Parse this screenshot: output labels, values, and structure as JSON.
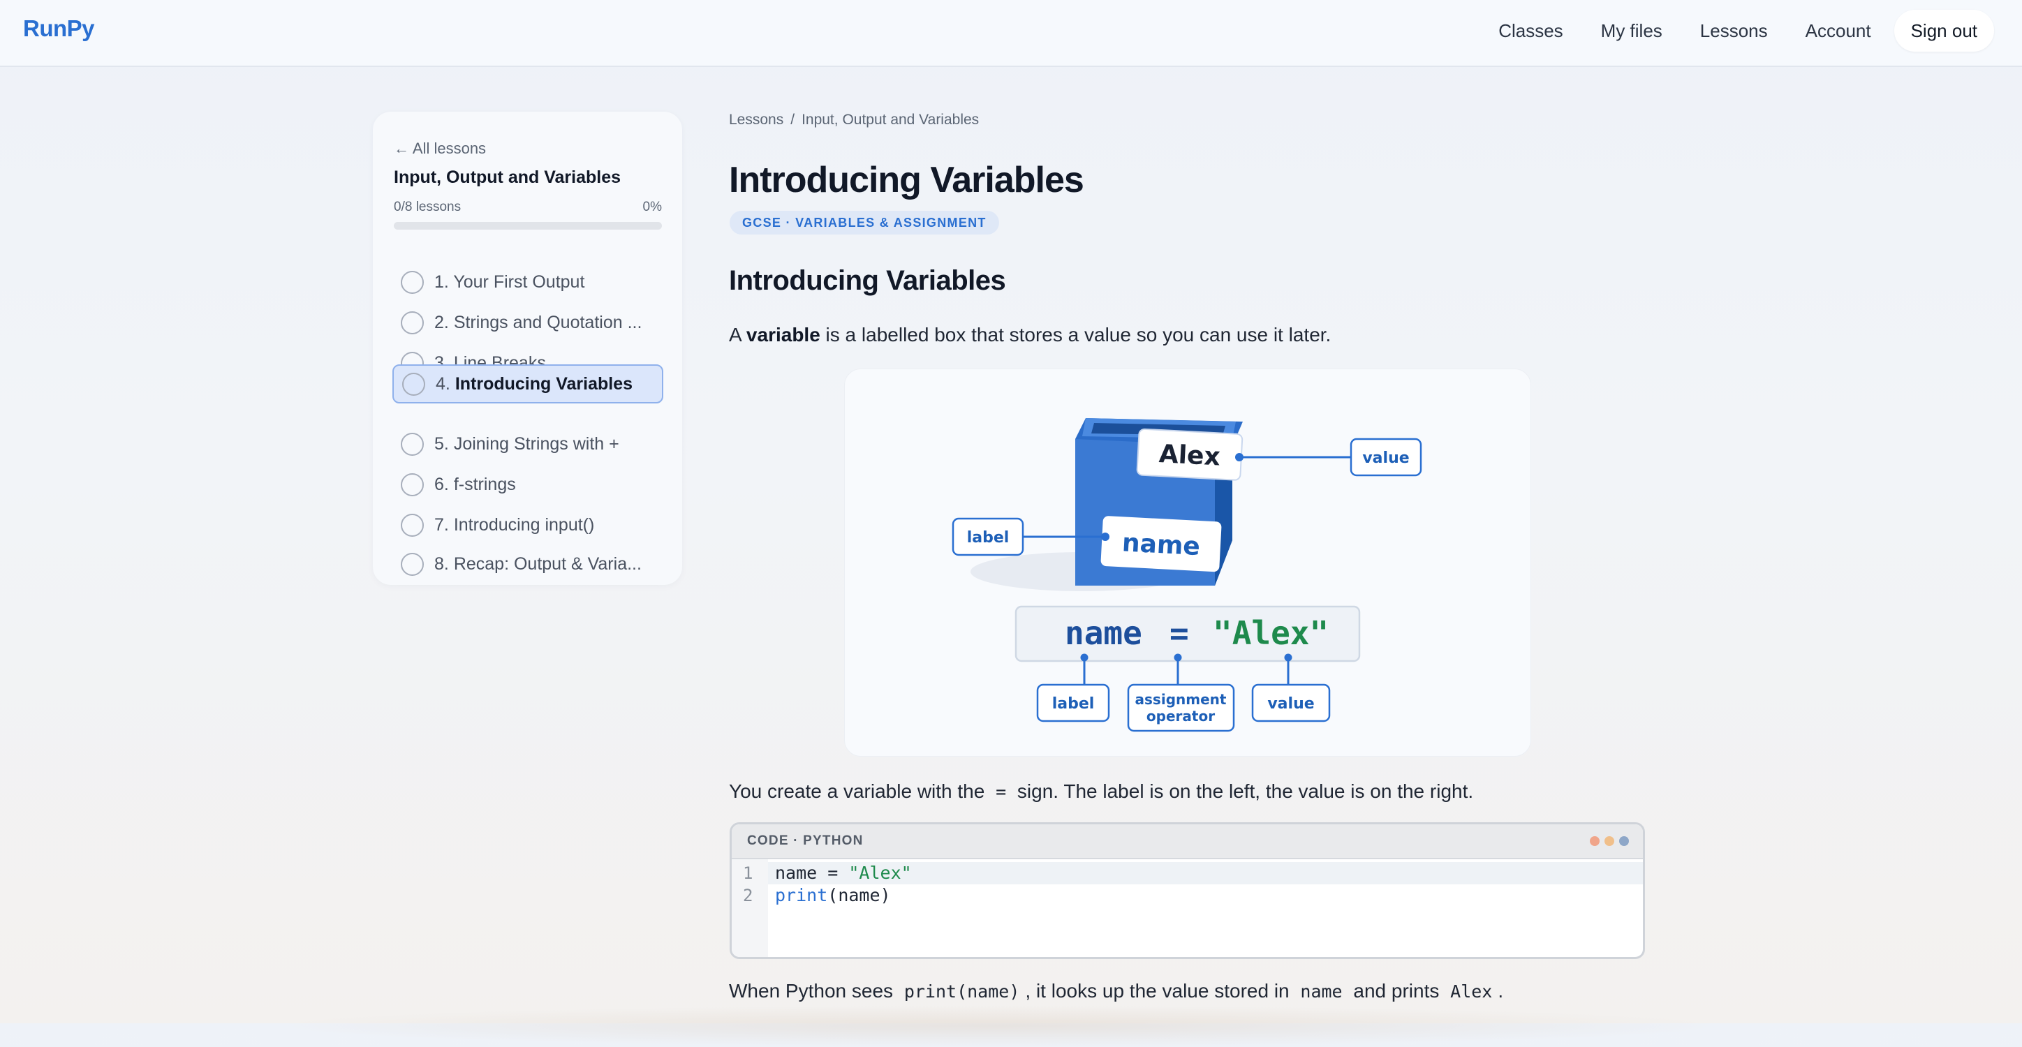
{
  "nav": {
    "brand": "RunPy",
    "links": [
      "Classes",
      "My files",
      "Lessons",
      "Account"
    ],
    "signout": "Sign out"
  },
  "sidebar": {
    "back": "← All lessons",
    "title": "Input, Output and Variables",
    "progress_label": "0/8 lessons",
    "progress_pct": "0%",
    "progress_fraction": 0,
    "lessons": [
      {
        "num": "1.",
        "title": "Your First Output"
      },
      {
        "num": "2.",
        "title": "Strings and Quotation ..."
      },
      {
        "num": "3.",
        "title": "Line Breaks"
      },
      {
        "num": "4.",
        "title": "Introducing Variables"
      },
      {
        "num": "5.",
        "title": "Joining Strings with +"
      },
      {
        "num": "6.",
        "title": "f-strings"
      },
      {
        "num": "7.",
        "title": "Introducing input()"
      },
      {
        "num": "8.",
        "title": "Recap: Output & Varia..."
      }
    ],
    "active_index": 3
  },
  "main": {
    "breadcrumb": [
      "Lessons",
      "/",
      "Input, Output and Variables"
    ],
    "title": "Introducing Variables",
    "tag": "GCSE · VARIABLES & ASSIGNMENT",
    "heading": "Introducing Variables",
    "intro_before": "A ",
    "intro_bold": "variable",
    "intro_after": " is a labelled box that stores a value so you can use it later.",
    "illustration": {
      "box_value": "Alex",
      "box_label": "name",
      "callout_value": "value",
      "callout_label": "label",
      "code_name": "name",
      "code_eq": "=",
      "code_val": "\"Alex\"",
      "bottom_label": "label",
      "bottom_assign_1": "assignment",
      "bottom_assign_2": "operator",
      "bottom_value": "value"
    },
    "para2_a": "You create a variable with the ",
    "para2_code": "=",
    "para2_b": " sign. The label is on the left, the value is on the right.",
    "code": {
      "lang": "CODE · PYTHON",
      "line_numbers": [
        "1",
        "2"
      ],
      "line1_plain": "name = ",
      "line1_str": "\"Alex\"",
      "line2_kw": "print",
      "line2_rest": "(name)"
    },
    "para3_a": "When Python sees ",
    "para3_code1": "print(name)",
    "para3_b": ", it looks up the value stored in ",
    "para3_code2": "name",
    "para3_c": " and prints ",
    "para3_code3": "Alex",
    "para3_d": "."
  },
  "colors": {
    "accent": "#2a6fd1",
    "string_green": "#1e8a4c",
    "dot_red": "#f0a58a",
    "dot_yellow": "#f0bf8a",
    "dot_blue": "#8ea7c8"
  }
}
